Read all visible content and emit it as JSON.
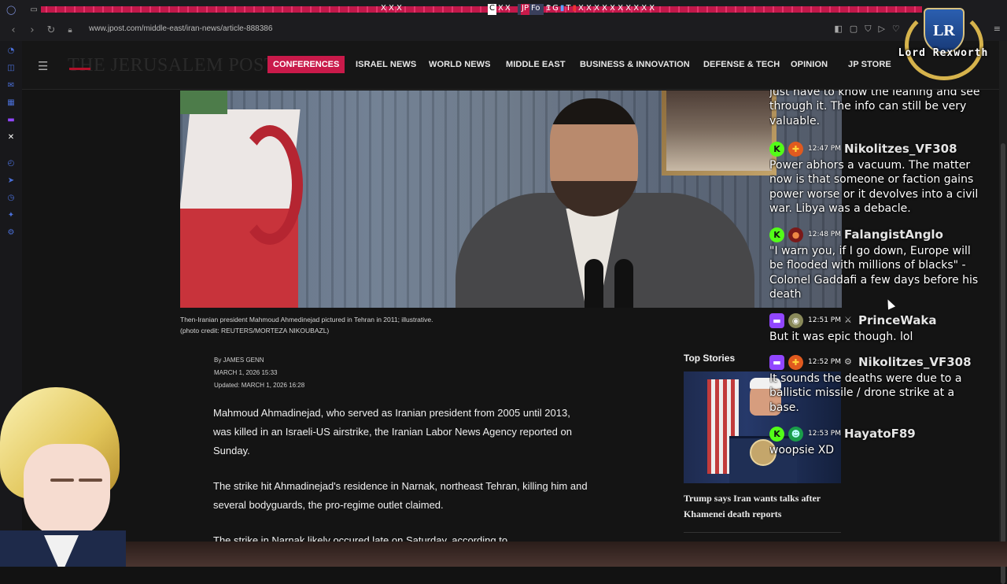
{
  "browser": {
    "url": "www.jpost.com/middle-east/iran-news/article-888386",
    "tab_glyphs": "X X X",
    "tab_glyphs_b": "X X X X X X X X X X",
    "tab_active": "Fo"
  },
  "header": {
    "logo_text": "THE JERUSALEM POST",
    "nav": [
      {
        "label": "CONFERENCES",
        "highlight": true
      },
      {
        "label": "ISRAEL NEWS"
      },
      {
        "label": "WORLD NEWS"
      },
      {
        "label": "MIDDLE EAST"
      },
      {
        "label": "BUSINESS & INNOVATION"
      },
      {
        "label": "DEFENSE & TECH"
      },
      {
        "label": "OPINION"
      },
      {
        "label": "JP STORE"
      }
    ],
    "accent_color": "#c91a4a"
  },
  "article": {
    "caption_1": "Then-Iranian president Mahmoud Ahmedinejad pictured in Tehran in 2011; illustrative.",
    "caption_2": "(photo credit: REUTERS/MORTEZA NIKOUBAZL)",
    "byline": "By JAMES GENN",
    "date": "MARCH 1, 2026 15:33",
    "updated": "Updated: MARCH 1, 2026 16:28",
    "paragraphs": [
      "Mahmoud Ahmadinejad, who served as Iranian president from 2005 until 2013, was killed in an Israeli-US airstrike, the Iranian Labor News Agency reported on Sunday.",
      "The strike hit Ahmadinejad's residence in Narnak, northeast Tehran, killing him and several bodyguards, the pro-regime outlet claimed.",
      "The strike in Narnak likely occured late on Saturday, according to"
    ]
  },
  "top_stories": {
    "heading": "Top Stories",
    "items": [
      {
        "title": "Trump says Iran wants talks after Khamenei death reports"
      }
    ]
  },
  "chat": {
    "partial_text": "just have to know the leaning and see through it. The info can still be very valuable.",
    "messages": [
      {
        "platform": "kick",
        "time": "12:47 PM",
        "user": "Nikolitzes_VF308",
        "text": "Power abhors a vacuum. The matter now is that someone or faction gains power worse or it devolves into a civil war. Libya was a debacle."
      },
      {
        "platform": "kick",
        "time": "12:48 PM",
        "user": "FalangistAnglo",
        "text": "\"I warn you, if I go down, Europe will be flooded with millions of blacks\" - Colonel Gaddafi a few days before his death"
      },
      {
        "platform": "twitch",
        "time": "12:51 PM",
        "user": "PrinceWaka",
        "text": "But it was epic though. lol"
      },
      {
        "platform": "twitch",
        "time": "12:52 PM",
        "user": "Nikolitzes_VF308",
        "text": "It sounds the deaths were due to a ballistic missile / drone strike at a base."
      },
      {
        "platform": "kick",
        "time": "12:53 PM",
        "user": "HayatoF89",
        "text": "woopsie XD"
      }
    ]
  },
  "overlay": {
    "watermark_name": "Lord Rexworth",
    "watermark_initials": "LR"
  }
}
